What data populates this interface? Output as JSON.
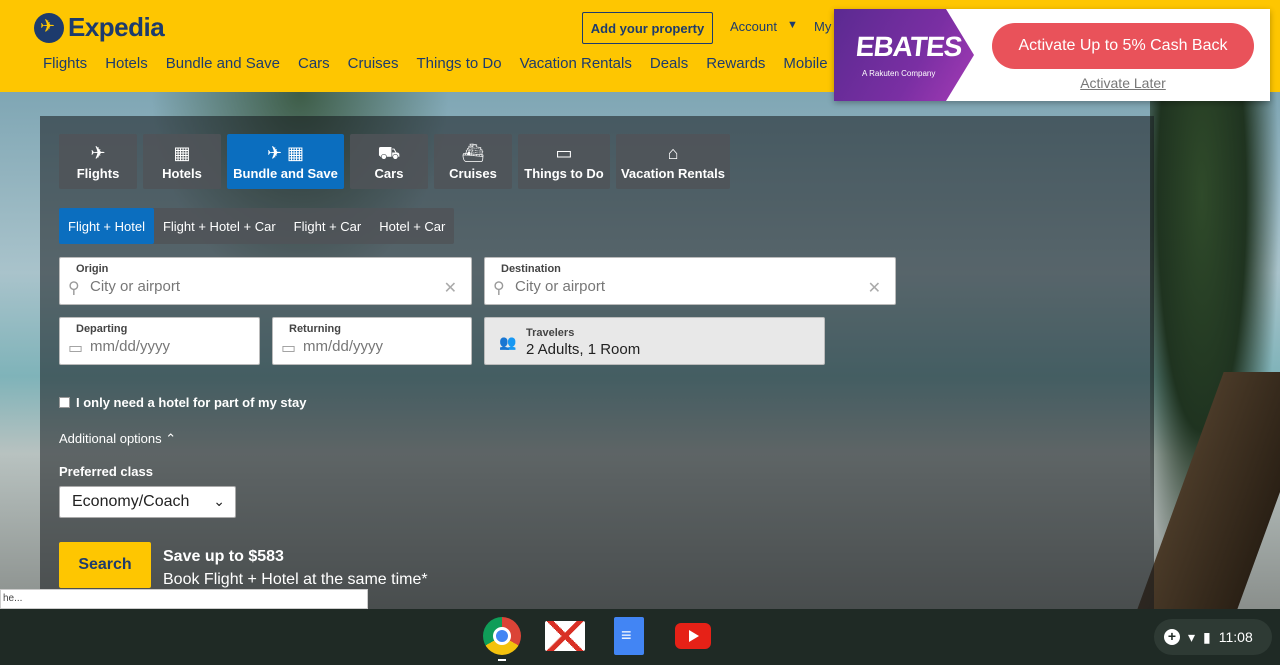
{
  "header": {
    "logo": "Expedia",
    "nav": [
      "Flights",
      "Hotels",
      "Bundle and Save",
      "Cars",
      "Cruises",
      "Things to Do",
      "Vacation Rentals",
      "Deals",
      "Rewards",
      "Mobile"
    ],
    "add_property": "Add your property",
    "account": "Account",
    "my": "My"
  },
  "ebates": {
    "logo": "EBATES",
    "sub": "A Rakuten Company",
    "cta": "Activate Up to 5% Cash Back",
    "later": "Activate Later"
  },
  "tabs": [
    {
      "label": "Flights",
      "icon": "✈"
    },
    {
      "label": "Hotels",
      "icon": "🏢"
    },
    {
      "label": "Bundle and Save",
      "icon": "✈ 🏢"
    },
    {
      "label": "Cars",
      "icon": "🚗"
    },
    {
      "label": "Cruises",
      "icon": "⛴"
    },
    {
      "label": "Things to Do",
      "icon": "🎟"
    },
    {
      "label": "Vacation Rentals",
      "icon": "⌂"
    }
  ],
  "subtabs": [
    "Flight + Hotel",
    "Flight + Hotel + Car",
    "Flight + Car",
    "Hotel + Car"
  ],
  "form": {
    "origin_label": "Origin",
    "origin_placeholder": "City or airport",
    "destination_label": "Destination",
    "destination_placeholder": "City or airport",
    "departing_label": "Departing",
    "departing_placeholder": "mm/dd/yyyy",
    "returning_label": "Returning",
    "returning_placeholder": "mm/dd/yyyy",
    "travelers_label": "Travelers",
    "travelers_value": "2 Adults, 1 Room",
    "hotel_partial": "I only need a hotel for part of my stay",
    "additional_options": "Additional options",
    "preferred_class_label": "Preferred class",
    "preferred_class_value": "Economy/Coach",
    "search": "Search",
    "save_title": "Save up to $583",
    "save_sub": "Book Flight + Hotel at the same time*"
  },
  "status_bubble": "he...",
  "tray": {
    "time": "11:08"
  }
}
